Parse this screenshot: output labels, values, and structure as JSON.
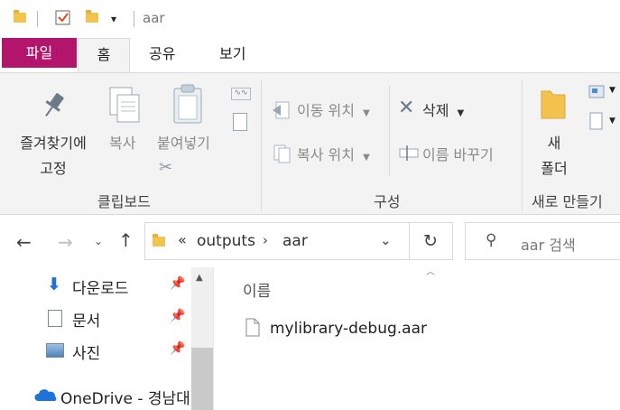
{
  "title": {
    "folder_name": "aar"
  },
  "ribbon_tabs": {
    "file": "파일",
    "home": "홈",
    "share": "공유",
    "view": "보기"
  },
  "clipboard": {
    "pin_label_line1": "즐겨찾기에",
    "pin_label_line2": "고정",
    "copy": "복사",
    "paste": "붙여넣기",
    "group": "클립보드"
  },
  "organize": {
    "move_to": "이동 위치",
    "copy_to": "복사 위치",
    "delete": "삭제",
    "rename": "이름 바꾸기",
    "group": "구성"
  },
  "new": {
    "new_folder_line1": "새",
    "new_folder_line2": "폴더",
    "group": "새로 만들기"
  },
  "address": {
    "overflow": "«",
    "crumbs": [
      "outputs",
      "aar"
    ]
  },
  "search": {
    "placeholder": "aar 검색"
  },
  "nav_pane": {
    "items": [
      {
        "label": "다운로드",
        "icon": "download-arrow-icon",
        "pinned": true
      },
      {
        "label": "문서",
        "icon": "document-icon",
        "pinned": true
      },
      {
        "label": "사진",
        "icon": "picture-icon",
        "pinned": true
      }
    ],
    "onedrive": "OneDrive - 경남대"
  },
  "content": {
    "column_header": "이름",
    "files": [
      {
        "name": "mylibrary-debug.aar",
        "icon": "file-icon"
      }
    ]
  },
  "colors": {
    "file_tab": "#b3146c",
    "folder": "#f3c44d",
    "accent_blue": "#1e73d8"
  }
}
